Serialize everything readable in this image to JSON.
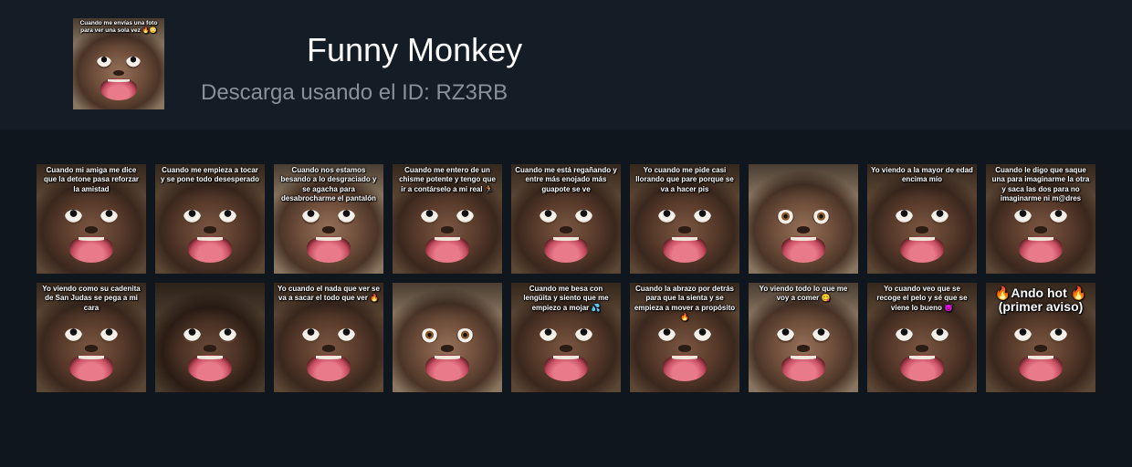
{
  "header": {
    "title": "Funny Monkey",
    "subtitle": "Descarga usando el ID: RZ3RB",
    "thumb_caption": "Cuando me envías una foto para ver una sola vez 🔥😳"
  },
  "stickers": [
    {
      "caption": "Cuando mi amiga me dice que la detone pasa reforzar la amistad"
    },
    {
      "caption": "Cuando me empieza a tocar y se pone todo desesperado"
    },
    {
      "caption": "Cuando nos estamos besando a lo desgraciado y se agacha para desabrocharme el pantalón"
    },
    {
      "caption": "Cuando me entero de un chisme potente y tengo que ir a contárselo a mi real 🏃"
    },
    {
      "caption": "Cuando me está regañando y entre más enojado más guapote se ve"
    },
    {
      "caption": "Yo cuando me pide casi llorando que pare porque se va a hacer pis"
    },
    {
      "caption": ""
    },
    {
      "caption": "Yo viendo a la mayor de edad encima mío"
    },
    {
      "caption": "Cuando le digo que saque una para imaginarme la otra y saca las dos para no imaginarme ni m@dres"
    },
    {
      "caption": "Yo viendo como su cadenita de San Judas se pega a mi cara"
    },
    {
      "caption": ""
    },
    {
      "caption": "Yo cuando el nada que ver se va a sacar el todo que ver 🔥"
    },
    {
      "caption": ""
    },
    {
      "caption": "Cuando me besa con lengüita y siento que me empiezo a mojar 💦"
    },
    {
      "caption": "Cuando la abrazo por detrás para que la sienta y se empieza a mover a propósito 🔥"
    },
    {
      "caption": "Yo viendo todo lo que me voy a comer 😋"
    },
    {
      "caption": "Yo cuando veo que se recoge el pelo y sé que se viene lo bueno 😈"
    },
    {
      "caption": "🔥Ando hot 🔥 (primer aviso)"
    }
  ]
}
